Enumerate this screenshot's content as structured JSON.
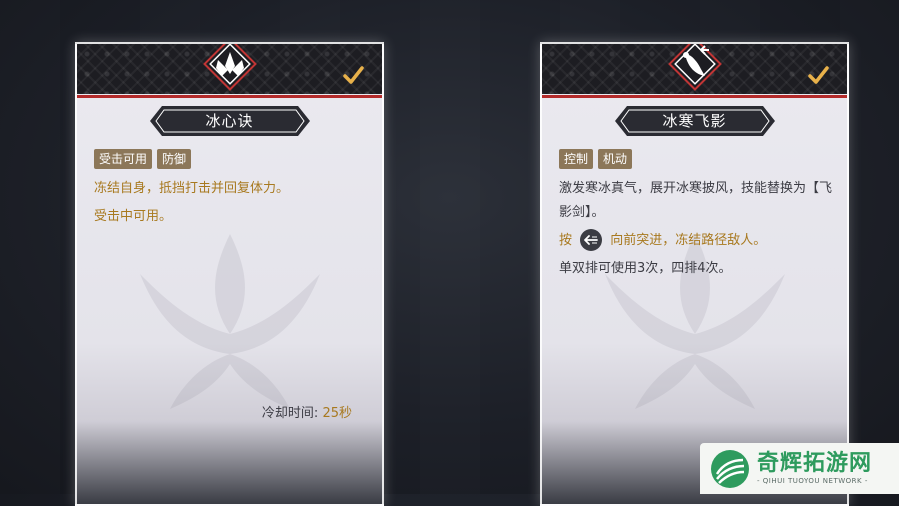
{
  "cards": [
    {
      "name": "冰心诀",
      "tags": [
        "受击可用",
        "防御"
      ],
      "desc1": "冻结自身，抵挡打击并回复体力。",
      "desc2": "受击中可用。",
      "cooldown_label": "冷却时间:",
      "cooldown_value": "25秒",
      "emblem_icon": "lotus-icon",
      "equipped_icon": "checkmark-icon"
    },
    {
      "name": "冰寒飞影",
      "tags": [
        "控制",
        "机动"
      ],
      "desc1": "激发寒冰真气，展开冰寒披风，技能替换为【飞影剑】。",
      "desc2_prefix": "按",
      "desc2_suffix": "向前突进，冻结路径敌人。",
      "desc3": "单双排可使用3次，四排4次。",
      "emblem_icon": "crane-icon",
      "inline_icon": "dash-arrow-icon",
      "equipped_icon": "checkmark-icon"
    }
  ],
  "watermark": {
    "title": "奇辉拓游网",
    "subtitle": "- QIHUI TUOYOU NETWORK -"
  },
  "colors": {
    "accent_gold": "#a8791f",
    "tag_bg": "#8c7759",
    "header_red": "#b32a2a",
    "brand_green": "#2e9b5e"
  }
}
